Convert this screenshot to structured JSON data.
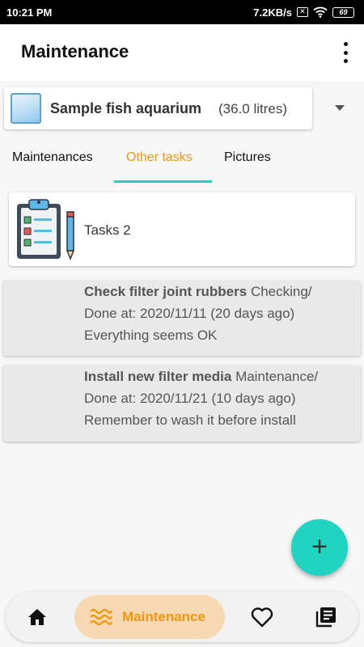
{
  "status_bar": {
    "time": "10:21 PM",
    "speed": "7.2KB/s",
    "battery": "69"
  },
  "app_bar": {
    "title": "Maintenance"
  },
  "aquarium": {
    "name": "Sample fish aquarium",
    "volume": "(36.0 litres)"
  },
  "tabs": [
    {
      "label": "Maintenances",
      "active": false
    },
    {
      "label": "Other tasks",
      "active": true
    },
    {
      "label": "Pictures",
      "active": false
    }
  ],
  "tasks_card": {
    "label": "Tasks 2"
  },
  "tasks": [
    {
      "name": "Check filter joint rubbers",
      "category": "Checking/",
      "done": "Done at: 2020/11/11 (20 days ago)",
      "note": "Everything seems OK"
    },
    {
      "name": "Install new filter media",
      "category": "Maintenance/",
      "done": "Done at: 2020/11/21 (10 days ago)",
      "note": "Remember to wash it before install"
    }
  ],
  "fab": {
    "label": "+"
  },
  "bottom_nav": {
    "active_label": "Maintenance"
  },
  "colors": {
    "accent": "#f0960c",
    "teal": "#1fd5c2",
    "pill": "#f6d9b3"
  }
}
